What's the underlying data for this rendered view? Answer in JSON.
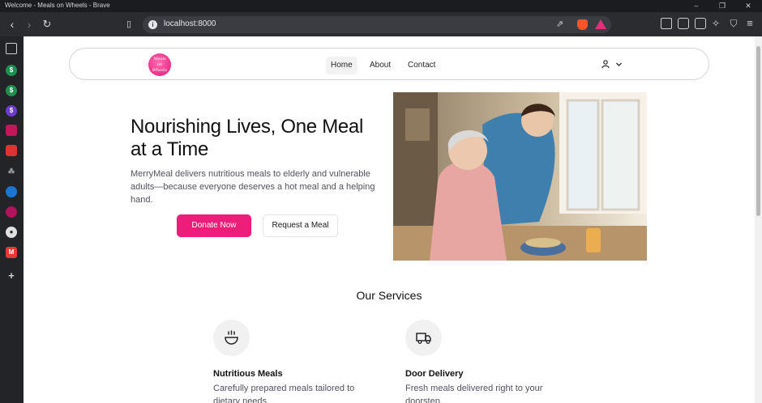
{
  "window": {
    "title": "Welcome - Meals on Wheels - Brave",
    "minimize": "–",
    "maximize": "❐",
    "close": "✕"
  },
  "toolbar": {
    "url": "localhost:8000",
    "info_glyph": "i"
  },
  "sidebar": {
    "items": [
      {
        "icon": "wallet-icon",
        "color": "#4a4b50"
      },
      {
        "icon": "green-s-icon",
        "color": "#1f8f4f"
      },
      {
        "icon": "green-s-icon",
        "color": "#1f8f4f"
      },
      {
        "icon": "purple-s-icon",
        "color": "#6c3bd1"
      },
      {
        "icon": "pink-app-icon",
        "color": "#c2185b"
      },
      {
        "icon": "red-app-icon",
        "color": "#d33"
      },
      {
        "icon": "network-icon",
        "color": "#8a8a8a"
      },
      {
        "icon": "blue-app-icon",
        "color": "#1976d2"
      },
      {
        "icon": "magenta-app-icon",
        "color": "#b0125b"
      },
      {
        "icon": "github-icon",
        "color": "#e0e0e0"
      },
      {
        "icon": "red-m-icon",
        "color": "#e53935"
      },
      {
        "icon": "add-icon",
        "color": "#232428"
      }
    ]
  },
  "nav": {
    "logo_line1": "Meals",
    "logo_line2": "on",
    "logo_line3": "Wheels",
    "links": [
      "Home",
      "About",
      "Contact"
    ],
    "active": "Home"
  },
  "hero": {
    "title": "Nourishing Lives, One Meal at a Time",
    "description": "MerryMeal delivers nutritious meals to elderly and vulnerable adults—because everyone deserves a hot meal and a helping hand.",
    "donate_label": "Donate Now",
    "request_label": "Request a Meal"
  },
  "services": {
    "title": "Our Services",
    "items": [
      {
        "title": "Nutritious Meals",
        "description": "Carefully prepared meals tailored to dietary needs.",
        "icon": "bowl-icon"
      },
      {
        "title": "Door Delivery",
        "description": "Fresh meals delivered right to your doorstep.",
        "icon": "truck-icon"
      }
    ]
  },
  "colors": {
    "accent": "#ed1e79"
  }
}
